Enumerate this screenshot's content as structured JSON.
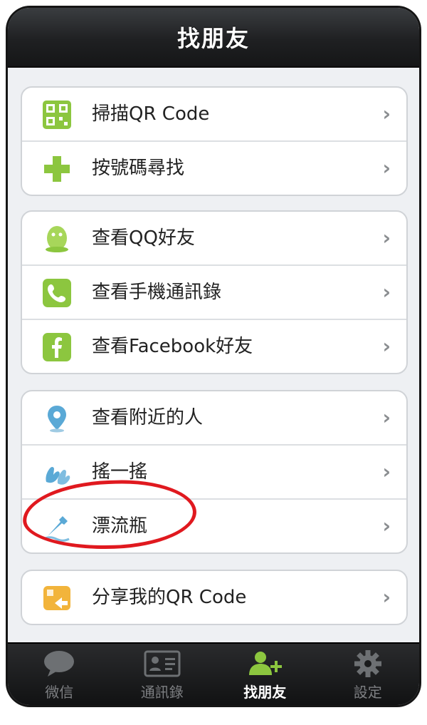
{
  "header": {
    "title": "找朋友"
  },
  "groups": [
    {
      "items": [
        {
          "label": "掃描QR Code",
          "icon": "qr-scan-icon",
          "chevron": "›"
        },
        {
          "label": "按號碼尋找",
          "icon": "plus-icon",
          "chevron": "›"
        }
      ]
    },
    {
      "items": [
        {
          "label": "查看QQ好友",
          "icon": "qq-icon",
          "chevron": "›"
        },
        {
          "label": "查看手機通訊錄",
          "icon": "phone-icon",
          "chevron": "›"
        },
        {
          "label": "查看Facebook好友",
          "icon": "facebook-icon",
          "chevron": "›"
        }
      ]
    },
    {
      "items": [
        {
          "label": "查看附近的人",
          "icon": "location-pin-icon",
          "chevron": "›"
        },
        {
          "label": "搖一搖",
          "icon": "shake-icon",
          "chevron": "›"
        },
        {
          "label": "漂流瓶",
          "icon": "bottle-icon",
          "chevron": "›"
        }
      ]
    },
    {
      "items": [
        {
          "label": "分享我的QR Code",
          "icon": "share-qr-icon",
          "chevron": "›"
        }
      ]
    }
  ],
  "tabs": [
    {
      "label": "微信",
      "icon": "chat-bubble-icon",
      "active": false
    },
    {
      "label": "通訊錄",
      "icon": "contacts-card-icon",
      "active": false
    },
    {
      "label": "找朋友",
      "icon": "find-friends-icon",
      "active": true
    },
    {
      "label": "設定",
      "icon": "gear-icon",
      "active": false
    }
  ],
  "colors": {
    "accent_green": "#8cc63f",
    "highlight_circle": "#e0191f",
    "title_bar": "#1f2022"
  }
}
